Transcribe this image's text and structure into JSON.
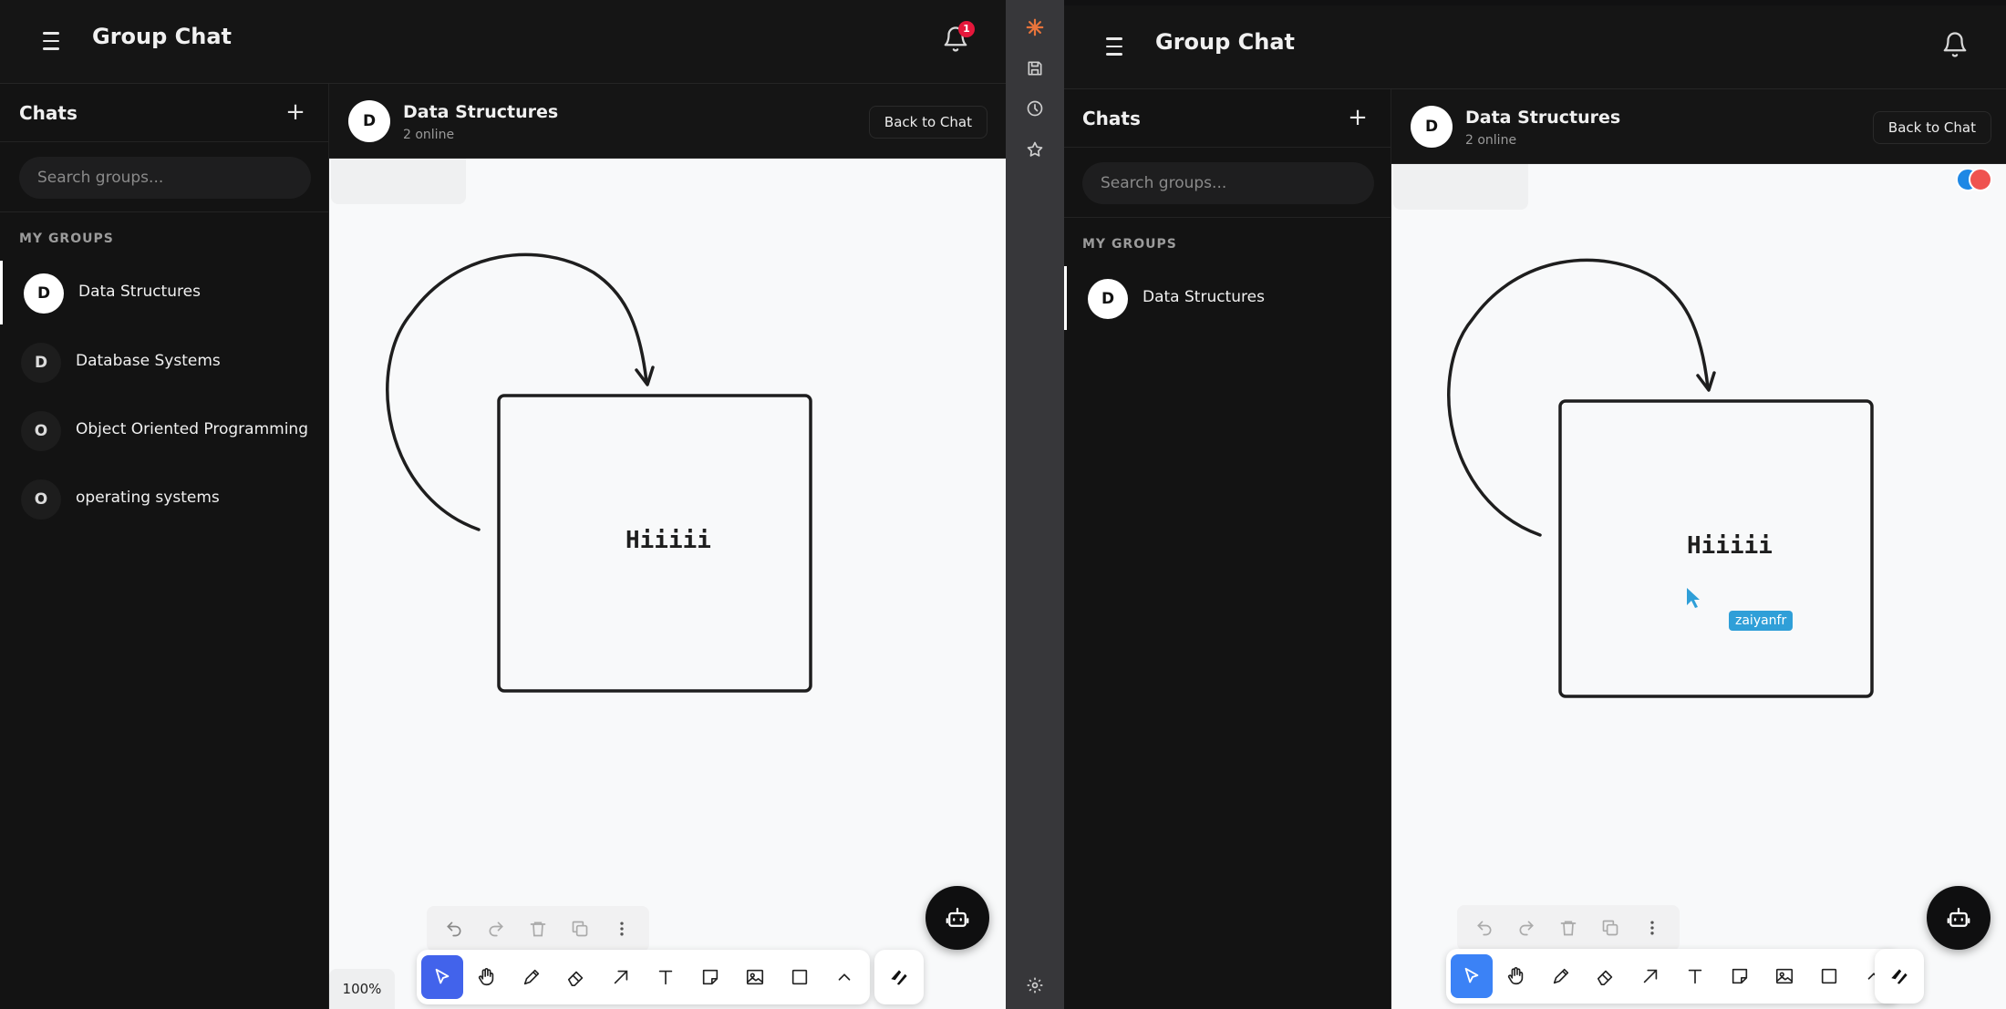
{
  "left": {
    "header": {
      "title": "Group Chat",
      "notification_count": "1"
    },
    "sidebar": {
      "title": "Chats",
      "add_label": "+",
      "search_placeholder": "Search groups...",
      "section_label": "MY GROUPS",
      "groups": [
        {
          "initial": "D",
          "name": "Data Structures",
          "active": true
        },
        {
          "initial": "D",
          "name": "Database Systems",
          "active": false
        },
        {
          "initial": "O",
          "name": "Object Oriented Programming",
          "active": false
        },
        {
          "initial": "O",
          "name": "operating systems",
          "active": false
        }
      ]
    },
    "chat": {
      "initial": "D",
      "name": "Data Structures",
      "status": "2 online",
      "back_label": "Back to Chat"
    },
    "canvas": {
      "shape_text": "Hiiiii",
      "zoom": "100%"
    }
  },
  "right": {
    "header": {
      "title": "Group Chat"
    },
    "sidebar": {
      "title": "Chats",
      "add_label": "+",
      "search_placeholder": "Search groups...",
      "section_label": "MY GROUPS",
      "groups": [
        {
          "initial": "D",
          "name": "Data Structures",
          "active": true
        }
      ]
    },
    "chat": {
      "initial": "D",
      "name": "Data Structures",
      "status": "2 online",
      "back_label": "Back to Chat"
    },
    "canvas": {
      "shape_text": "Hiiiii",
      "cursor_user": "zaiyanfr"
    }
  },
  "colors": {
    "selected_tool": "#4263eb",
    "selected_tool_right": "#3b82f6",
    "notification_badge": "#e5173b",
    "cursor_tag": "#2f9fd8",
    "presence_blue": "#1e88e5",
    "presence_red": "#ef5350",
    "strip_logo": "#e8743b"
  },
  "toolbar_tools": [
    "select-icon",
    "hand-icon",
    "pencil-icon",
    "eraser-icon",
    "arrow-icon",
    "text-icon",
    "sticky-note-icon",
    "image-icon",
    "rectangle-icon",
    "chevron-up-icon"
  ],
  "sub_tools": [
    "undo-icon",
    "redo-icon",
    "trash-icon",
    "duplicate-icon",
    "more-icon"
  ],
  "side_strip_icons": [
    "claude-logo-icon",
    "save-icon",
    "history-icon",
    "star-icon",
    "settings-icon"
  ]
}
